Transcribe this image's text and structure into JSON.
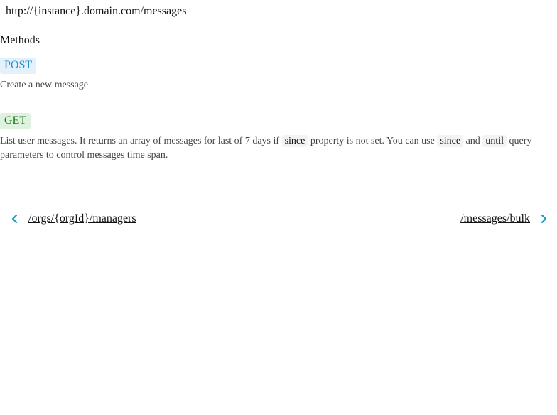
{
  "endpoint": {
    "url": "http://{instance}.domain.com/messages"
  },
  "methods": {
    "heading": "Methods",
    "post": {
      "label": "POST",
      "description": "Create a new message",
      "color": "#1f8fd6",
      "background": "#e3f1fa"
    },
    "get": {
      "label": "GET",
      "description_part1": "List user messages. It returns an array of messages for last of 7 days if ",
      "code_since_1": "since",
      "description_part2": " property is not set. You can use ",
      "code_since_2": "since",
      "description_part3": " and ",
      "code_until": "until",
      "description_part4": " query parameters to control messages time span.",
      "color": "#1b7a1b",
      "background": "#dff2df"
    }
  },
  "pagination": {
    "prev": {
      "label": "/orgs/{orgId}/managers",
      "icon": "chevron-left-icon"
    },
    "next": {
      "label": "/messages/bulk",
      "icon": "chevron-right-icon"
    },
    "icon_color": "#1a9bbf"
  }
}
